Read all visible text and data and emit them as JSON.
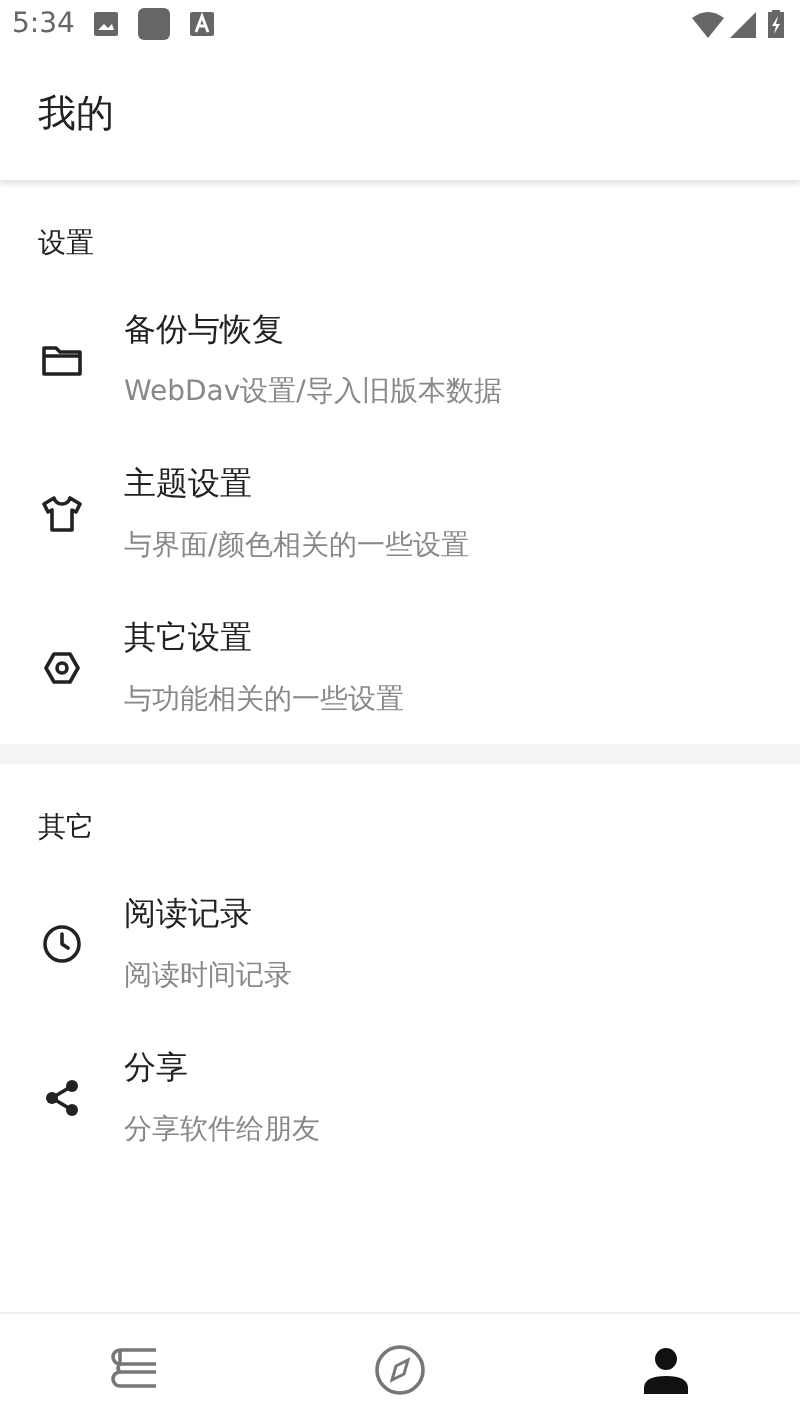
{
  "status_bar": {
    "time": "5:34"
  },
  "app_bar": {
    "title": "我的"
  },
  "sections": [
    {
      "header": "设置",
      "items": [
        {
          "title": "备份与恢复",
          "subtitle": "WebDav设置/导入旧版本数据"
        },
        {
          "title": "主题设置",
          "subtitle": "与界面/颜色相关的一些设置"
        },
        {
          "title": "其它设置",
          "subtitle": "与功能相关的一些设置"
        }
      ]
    },
    {
      "header": "其它",
      "items": [
        {
          "title": "阅读记录",
          "subtitle": "阅读时间记录"
        },
        {
          "title": "分享",
          "subtitle": "分享软件给朋友"
        }
      ]
    }
  ],
  "bottom_nav": [
    {
      "selected": false
    },
    {
      "selected": false
    },
    {
      "selected": true
    }
  ]
}
